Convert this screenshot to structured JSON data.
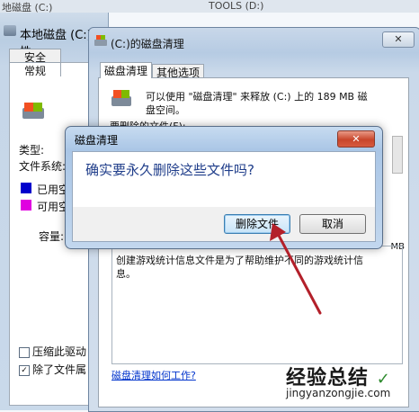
{
  "top": {
    "left_text": "地磁盘 (C:)",
    "right_text": "TOOLS (D:)"
  },
  "back_window": {
    "title": "本地磁盘 (C:) 属性",
    "tabs": [
      "安全",
      "常规"
    ],
    "type_label": "类型:",
    "fs_label": "文件系统:",
    "used_label": "已用空",
    "free_label": "可用空",
    "capacity_label": "容量:",
    "compress_label": "压缩此驱动",
    "index_label": "除了文件属",
    "colors": {
      "used": "#0000cc",
      "free": "#e000e0"
    }
  },
  "cleanup_window": {
    "title": "(C:)的磁盘清理",
    "close": "✕",
    "tabs": [
      "磁盘清理",
      "其他选项"
    ],
    "desc_line1": "可以使用 \"磁盘清理\" 来释放  (C:) 上的 189 MB 磁",
    "desc_line2": "盘空间。",
    "delete_files_label": "要删除的文件(F):",
    "size_suffix": "MB",
    "description_text1": "创建游戏统计信息文件是为了帮助维护不同的游戏统计信",
    "description_text2": "息。",
    "how_link": "磁盘清理如何工作?"
  },
  "dialog": {
    "title": "磁盘清理",
    "close": "✕",
    "message": "确实要永久删除这些文件吗?",
    "delete_button": "删除文件",
    "cancel_button": "取消"
  },
  "watermark": {
    "main": "经验总结",
    "sub": "jingyanzongjie.com"
  }
}
